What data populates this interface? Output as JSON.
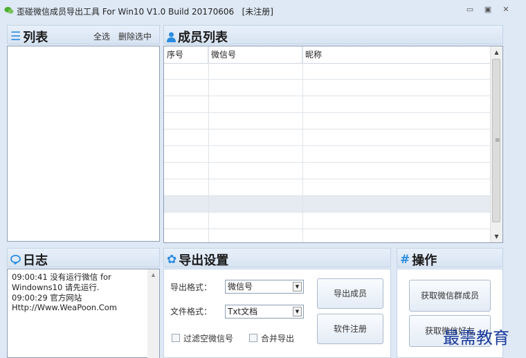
{
  "titlebar": {
    "title": "歪碰微信成员导出工具 For Win10 V1.0 Build 20170606",
    "status": "[未注册]",
    "minimize": "▭",
    "restore": "▣",
    "close": "✕"
  },
  "list_panel": {
    "title": "列表",
    "select_all": "全选",
    "delete_selected": "删除选中"
  },
  "members_panel": {
    "title": "成员列表",
    "columns": [
      "序号",
      "微信号",
      "昵称"
    ],
    "rows": 11,
    "selected_row": 8
  },
  "log_panel": {
    "title": "日志",
    "lines": [
      "09:00:41   没有运行微信 for",
      "Windowns10 请先运行.",
      "09:00:29   官方网站",
      "Http://Www.WeaPoon.Com"
    ]
  },
  "export_panel": {
    "title": "导出设置",
    "format_label": "导出格式：",
    "format_value": "微信号",
    "file_label": "文件格式：",
    "file_value": "Txt文档",
    "export_button": "导出成员",
    "register_button": "软件注册",
    "filter_label": "过滤空微信号",
    "merge_label": "合并导出"
  },
  "ops_panel": {
    "title": "操作",
    "get_group_button": "获取微信群成员",
    "get_friends_button": "获取微信好友"
  },
  "watermark": "最需教育",
  "colors": {
    "accent": "#2a8be0",
    "watermark": "#1a3a9a"
  }
}
